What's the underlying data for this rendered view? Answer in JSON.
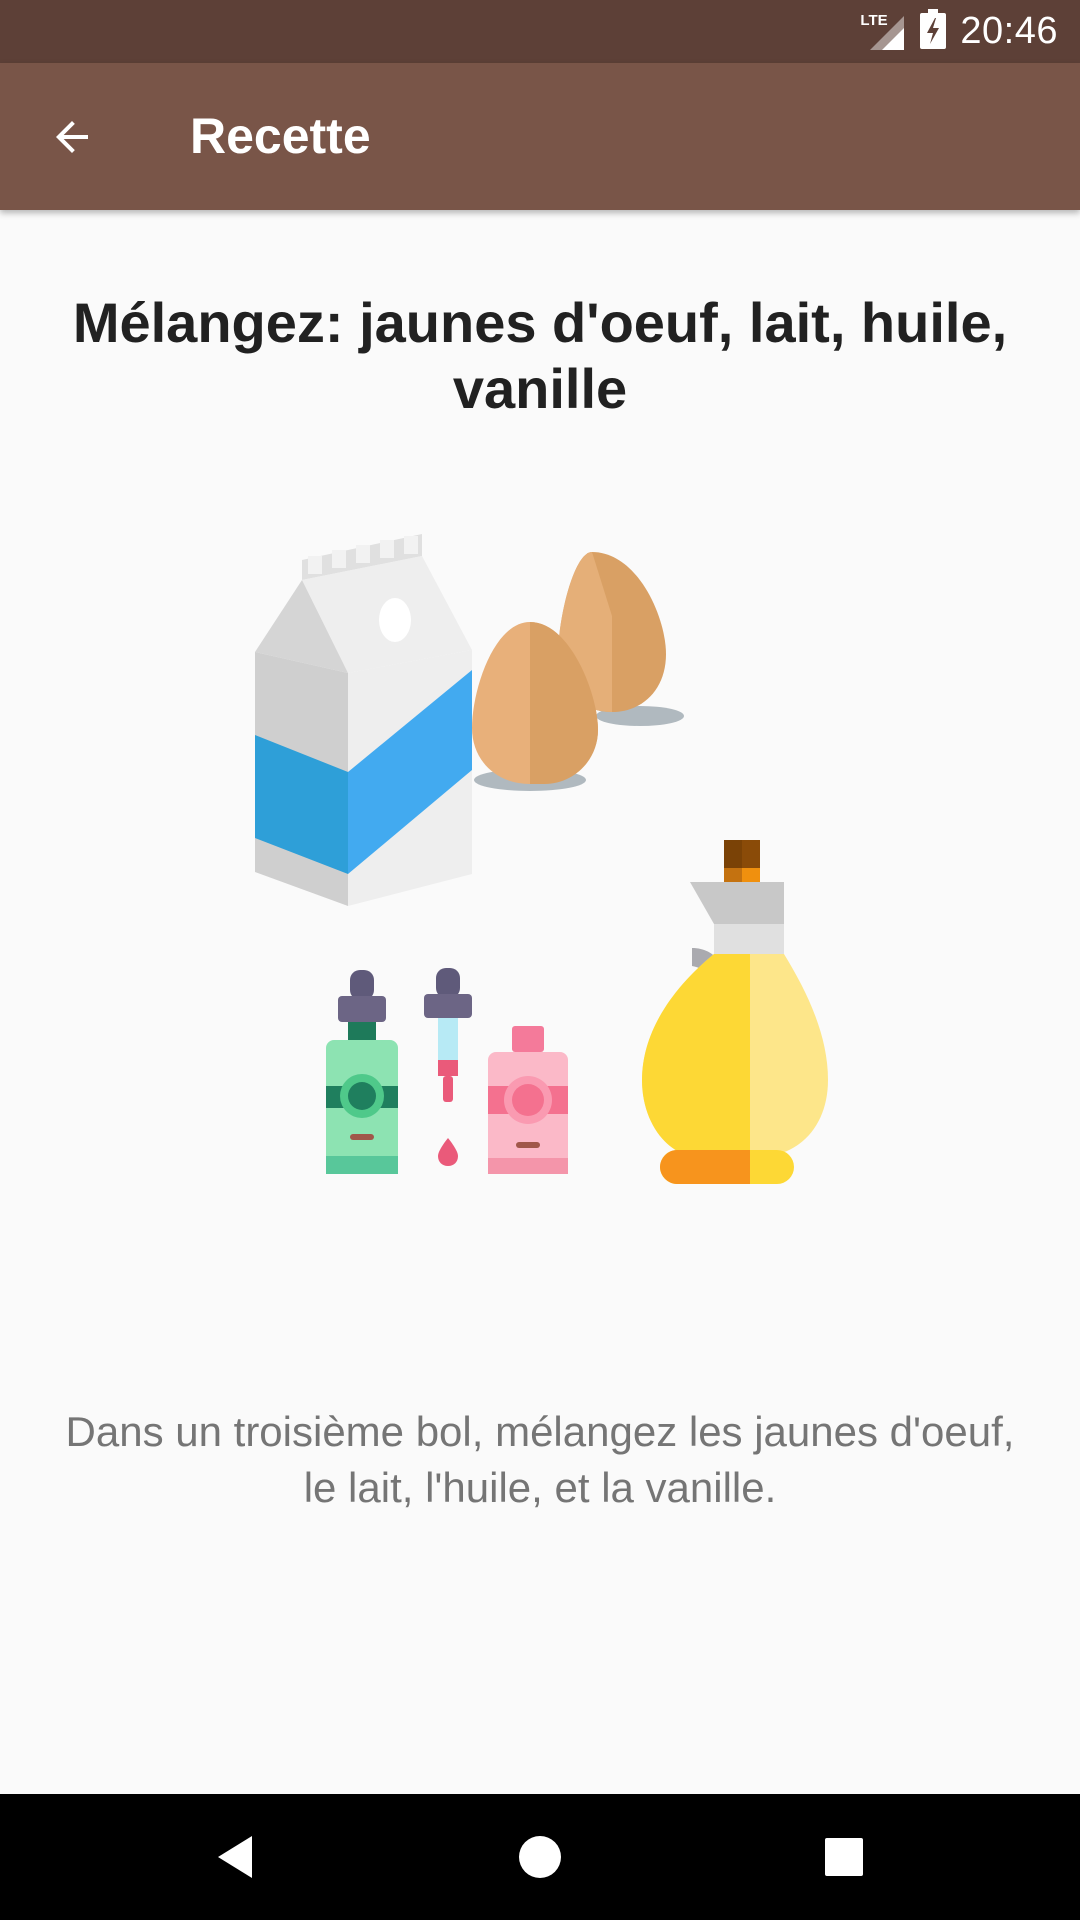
{
  "status_bar": {
    "network": "LTE",
    "time": "20:46",
    "icons": [
      "lte-signal-icon",
      "battery-charging-icon"
    ]
  },
  "app_bar": {
    "title": "Recette",
    "back_icon": "arrow-back-icon"
  },
  "step": {
    "title": "Mélangez: jaunes d'oeuf, lait, huile, vanille",
    "description": "Dans un troisième bol, mélangez les jaunes d'oeuf, le lait, l'huile, et la vanille.",
    "illustration_items": [
      "milk-carton-icon",
      "eggs-icon",
      "vanilla-bottles-icon",
      "oil-jug-icon"
    ]
  },
  "nav_bar": {
    "icons": [
      "nav-back-icon",
      "nav-home-icon",
      "nav-recents-icon"
    ]
  },
  "colors": {
    "status_bar": "#5d4037",
    "app_bar": "#795548",
    "background": "#fafafa",
    "title_text": "#212121",
    "body_text": "#757575"
  }
}
